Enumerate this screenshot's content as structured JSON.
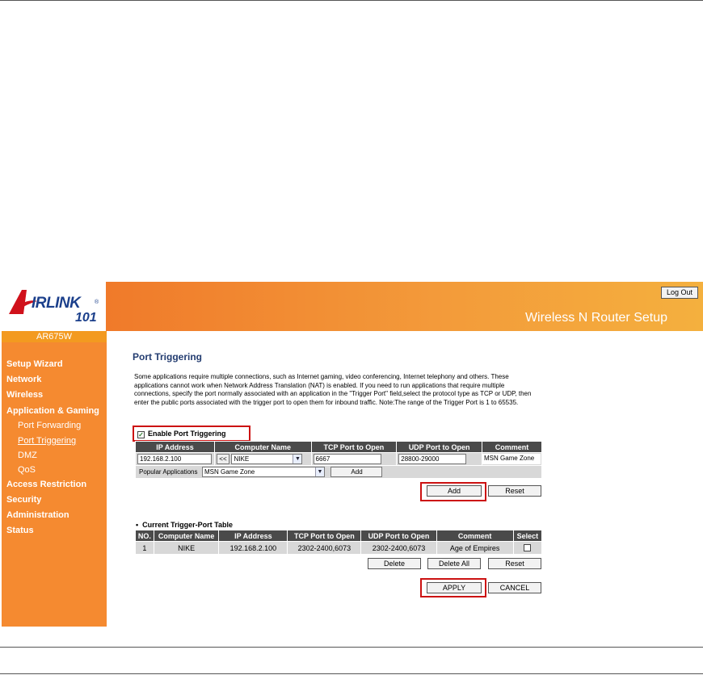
{
  "header": {
    "brand": "IRLINK",
    "brand_101": "101",
    "brand_reg": "®",
    "title": "Wireless N Router Setup",
    "logout": "Log Out",
    "model": "AR675W"
  },
  "sidebar": {
    "items": [
      {
        "label": "Setup Wizard"
      },
      {
        "label": "Network"
      },
      {
        "label": "Wireless"
      },
      {
        "label": "Application & Gaming"
      },
      {
        "label": "Port Forwarding"
      },
      {
        "label": "Port Triggering"
      },
      {
        "label": "DMZ"
      },
      {
        "label": "QoS"
      },
      {
        "label": "Access Restriction"
      },
      {
        "label": "Security"
      },
      {
        "label": "Administration"
      },
      {
        "label": "Status"
      }
    ]
  },
  "main": {
    "title": "Port Triggering",
    "description": "Some applications require multiple connections, such as Internet gaming, video conferencing, Internet telephony and others. These applications cannot work when Network Address Translation (NAT) is enabled. If you need to run applications that require multiple connections, specify the port normally associated with an application in the \"Trigger Port\" field,select the protocol type as TCP or UDP, then enter the public ports associated with the trigger port to open them for inbound traffic. Note:The range of the Trigger Port is 1 to 65535.",
    "enable_label": "Enable Port Triggering",
    "enable_checked": "✓",
    "entry": {
      "headers": [
        "IP Address",
        "Computer Name",
        "TCP Port to Open",
        "UDP Port to Open",
        "Comment"
      ],
      "ip": "192.168.2.100",
      "copy_btn": "<<",
      "computer": "NIKE",
      "tcp": "6667",
      "udp": "28800-29000",
      "comment": "MSN Game Zone",
      "popular_label": "Popular Applications",
      "popular_value": "MSN Game Zone",
      "popular_add": "Add",
      "add": "Add",
      "reset": "Reset"
    },
    "table": {
      "caption": "Current Trigger-Port Table",
      "headers": [
        "NO.",
        "Computer Name",
        "IP Address",
        "TCP Port to Open",
        "UDP Port to Open",
        "Comment",
        "Select"
      ],
      "rows": [
        [
          "1",
          "NIKE",
          "192.168.2.100",
          "2302-2400,6073",
          "2302-2400,6073",
          "Age of Empires"
        ]
      ],
      "delete": "Delete",
      "delete_all": "Delete All",
      "reset": "Reset"
    },
    "apply": "APPLY",
    "cancel": "CANCEL"
  }
}
